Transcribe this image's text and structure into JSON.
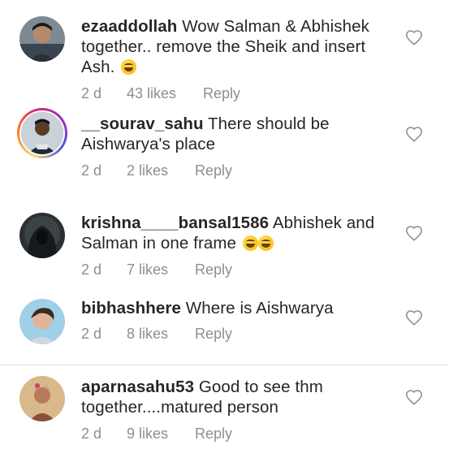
{
  "comments": [
    {
      "username": "ezaaddollah",
      "text": " Wow Salman & Abhishek together.. remove the Sheik and insert Ash.",
      "emoji": "😂",
      "time": "2 d",
      "likes": "43 likes",
      "reply": "Reply"
    },
    {
      "username": "__sourav_sahu",
      "text": " There should be Aishwarya's place",
      "time": "2 d",
      "likes": "2 likes",
      "reply": "Reply"
    },
    {
      "username": "krishna____bansal1586",
      "text": " Abhishek and Salman in one frame",
      "emoji": "😂😂",
      "time": "2 d",
      "likes": "7 likes",
      "reply": "Reply"
    },
    {
      "username": "bibhashhere",
      "text": " Where is Aishwarya",
      "time": "2 d",
      "likes": "8 likes",
      "reply": "Reply"
    },
    {
      "username": "aparnasahu53",
      "text": " Good to see thm together....matured person",
      "time": "2 d",
      "likes": "9 likes",
      "reply": "Reply"
    }
  ],
  "icons": {
    "like": "heart-outline-icon",
    "emoji": "face-with-tears-of-joy-icon"
  },
  "colors": {
    "text": "#262626",
    "secondary": "#8e8e8e",
    "heart": "#8e8e8e"
  }
}
